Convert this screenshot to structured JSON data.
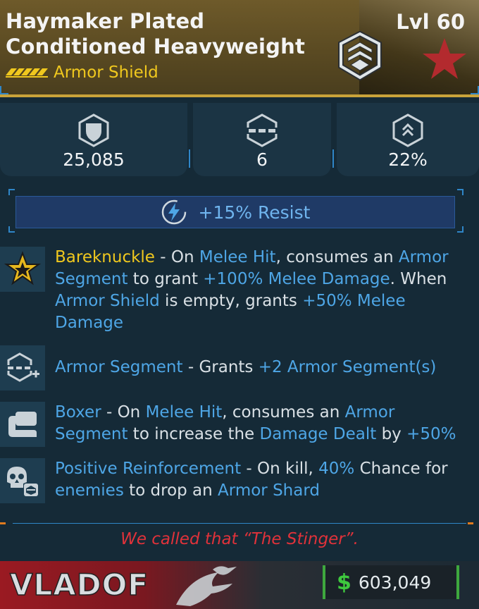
{
  "header": {
    "name": "Haymaker Plated Conditioned Heavyweight",
    "type": "Armor Shield",
    "level": "Lvl 60"
  },
  "stats": [
    {
      "icon": "shield-capacity-icon",
      "value": "25,085"
    },
    {
      "icon": "armor-segment-icon",
      "value": "6"
    },
    {
      "icon": "armor-boost-icon",
      "value": "22%"
    }
  ],
  "resist": {
    "icon": "lightning-icon",
    "text": "+15% Resist"
  },
  "perks": [
    {
      "icon": "bareknuckle-star-icon",
      "parts": [
        {
          "t": "Bareknuckle",
          "c": "nm"
        },
        {
          "t": " - On ",
          "c": ""
        },
        {
          "t": "Melee Hit",
          "c": "kw"
        },
        {
          "t": ", consumes an ",
          "c": ""
        },
        {
          "t": "Armor Segment",
          "c": "kw"
        },
        {
          "t": " to grant ",
          "c": ""
        },
        {
          "t": "+100% Melee Damage",
          "c": "kw"
        },
        {
          "t": ". When ",
          "c": ""
        },
        {
          "t": "Armor Shield",
          "c": "kw"
        },
        {
          "t": " is empty, grants ",
          "c": ""
        },
        {
          "t": "+50% Melee Damage",
          "c": "kw"
        }
      ]
    },
    {
      "icon": "armor-segment-plus-icon",
      "parts": [
        {
          "t": "Armor Segment",
          "c": "kw"
        },
        {
          "t": " - Grants ",
          "c": ""
        },
        {
          "t": "+2 Armor Segment(s)",
          "c": "kw"
        }
      ]
    },
    {
      "icon": "boxer-fist-icon",
      "parts": [
        {
          "t": "Boxer",
          "c": "kw"
        },
        {
          "t": " - On ",
          "c": ""
        },
        {
          "t": "Melee Hit",
          "c": "kw"
        },
        {
          "t": ", consumes an ",
          "c": ""
        },
        {
          "t": "Armor Segment",
          "c": "kw"
        },
        {
          "t": " to increase the ",
          "c": ""
        },
        {
          "t": "Damage Dealt",
          "c": "kw"
        },
        {
          "t": " by ",
          "c": ""
        },
        {
          "t": "+50%",
          "c": "kw"
        }
      ]
    },
    {
      "icon": "skull-shard-icon",
      "parts": [
        {
          "t": "Positive Reinforcement",
          "c": "kw"
        },
        {
          "t": " - On kill, ",
          "c": ""
        },
        {
          "t": "40%",
          "c": "kw"
        },
        {
          "t": " Chance for ",
          "c": ""
        },
        {
          "t": "enemies",
          "c": "kw"
        },
        {
          "t": " to drop an ",
          "c": ""
        },
        {
          "t": "Armor Shard",
          "c": "kw"
        }
      ]
    }
  ],
  "footer": {
    "flavor": "We called that “The Stinger”.",
    "manufacturer": "VLADOF",
    "currency_symbol": "$",
    "price": "603,049"
  },
  "colors": {
    "rarity": "#f0c81e",
    "keyword": "#4ea6e6",
    "flavor": "#e0323a",
    "price_accent": "#3ea83e"
  }
}
